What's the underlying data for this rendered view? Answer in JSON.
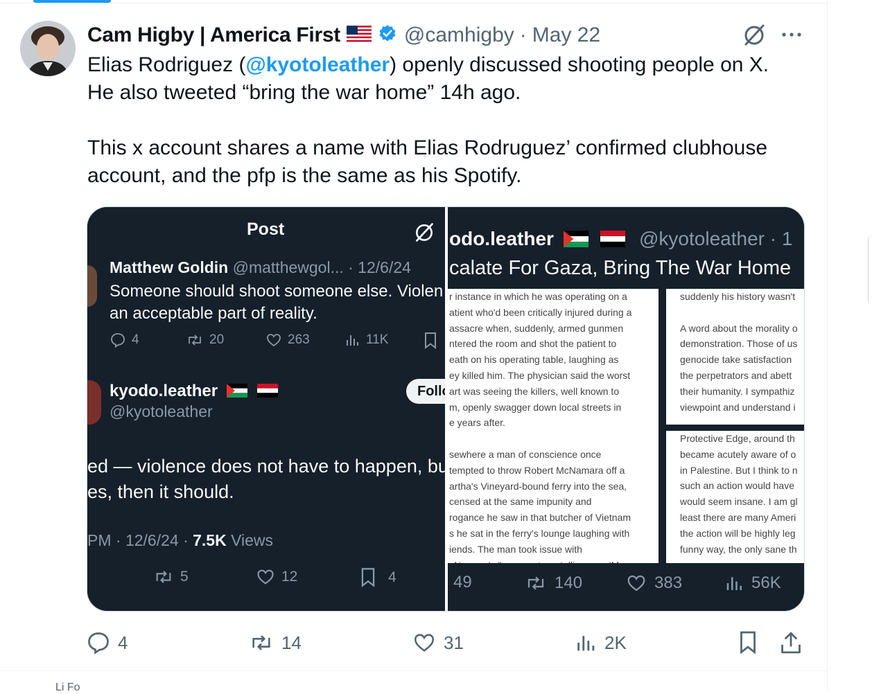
{
  "author": {
    "name": "Cam Higby | America First",
    "handle": "@camhigby",
    "separator": "·",
    "date": "May 22"
  },
  "tweet": {
    "line1_pre": "Elias Rodriguez (",
    "mention": "@kyotoleather",
    "line1_post": ") openly discussed shooting people on X.",
    "line2": "He also tweeted “bring the war home” 14h ago.",
    "line3": "This x account shares a name with Elias Rodruguez’ confirmed clubhouse",
    "line4": "account, and the pfp is the same as his Spotify."
  },
  "screenshot_left": {
    "header_title": "Post",
    "quoted_name": "Matthew Goldin",
    "quoted_handle_date": "@matthewgol... · 12/6/24",
    "quoted_text_1": "Someone should shoot someone else. Violen",
    "quoted_text_2": "an acceptable part of reality.",
    "quoted_replies": "4",
    "quoted_reposts": "20",
    "quoted_likes": "263",
    "quoted_views": "11K",
    "reply_name": "kyodo.leather",
    "reply_handle": "@kyotoleather",
    "follow_label": "Follo",
    "reply_text_1": "ed — violence does not have to happen, bu",
    "reply_text_2": "es, then it should.",
    "meta_time": "PM · 12/6/24 · ",
    "meta_views_count": "7.5K",
    "meta_views_label": " Views",
    "reposts": "5",
    "likes": "12",
    "bookmarks": "4"
  },
  "screenshot_right": {
    "profile_name": "odo.leather",
    "profile_handle": "@kyotoleather · 1",
    "bio": "calate For Gaza, Bring The War Home",
    "doc_a_lines": [
      "r instance in which he was operating on a",
      "atient who'd been critically injured during a",
      "assacre when, suddenly, armed gunmen",
      "ntered the room and shot the patient to",
      "eath on his operating table, laughing as",
      "ey killed him. The physician said the worst",
      "art was seeing the killers, well known to",
      "m, openly swagger down local streets in",
      "e years after.",
      "",
      "sewhere a man of conscience once",
      "tempted to throw Robert McNamara off a",
      "artha's Vineyard-bound ferry into the sea,",
      "censed at the same impunity and",
      "rogance he saw in that butcher of Vietnam",
      "s he sat in the ferry's lounge laughing with",
      "iends. The man took issue with",
      "cNamara's \"very posture, telling you, 'My"
    ],
    "doc_b_lines": [
      "suddenly his history wasn't",
      "",
      "A word about the morality o",
      "demonstration. Those of us",
      "genocide take satisfaction",
      "the perpetrators and abett",
      "their humanity. I sympathiz",
      "viewpoint and understand i"
    ],
    "doc_c_lines": [
      "Protective Edge, around th",
      "became acutely aware of o",
      "in Palestine. But I think to n",
      "such an action would have",
      "would seem insane. I am gl",
      "least there are many Ameri",
      "the action will be highly leg",
      "funny way, the only sane th"
    ],
    "replies": "49",
    "reposts": "140",
    "likes": "383",
    "views": "56K"
  },
  "actions": {
    "replies": "4",
    "reposts": "14",
    "likes": "31",
    "views": "2K"
  },
  "bottom_strip": "Li                  Fo"
}
